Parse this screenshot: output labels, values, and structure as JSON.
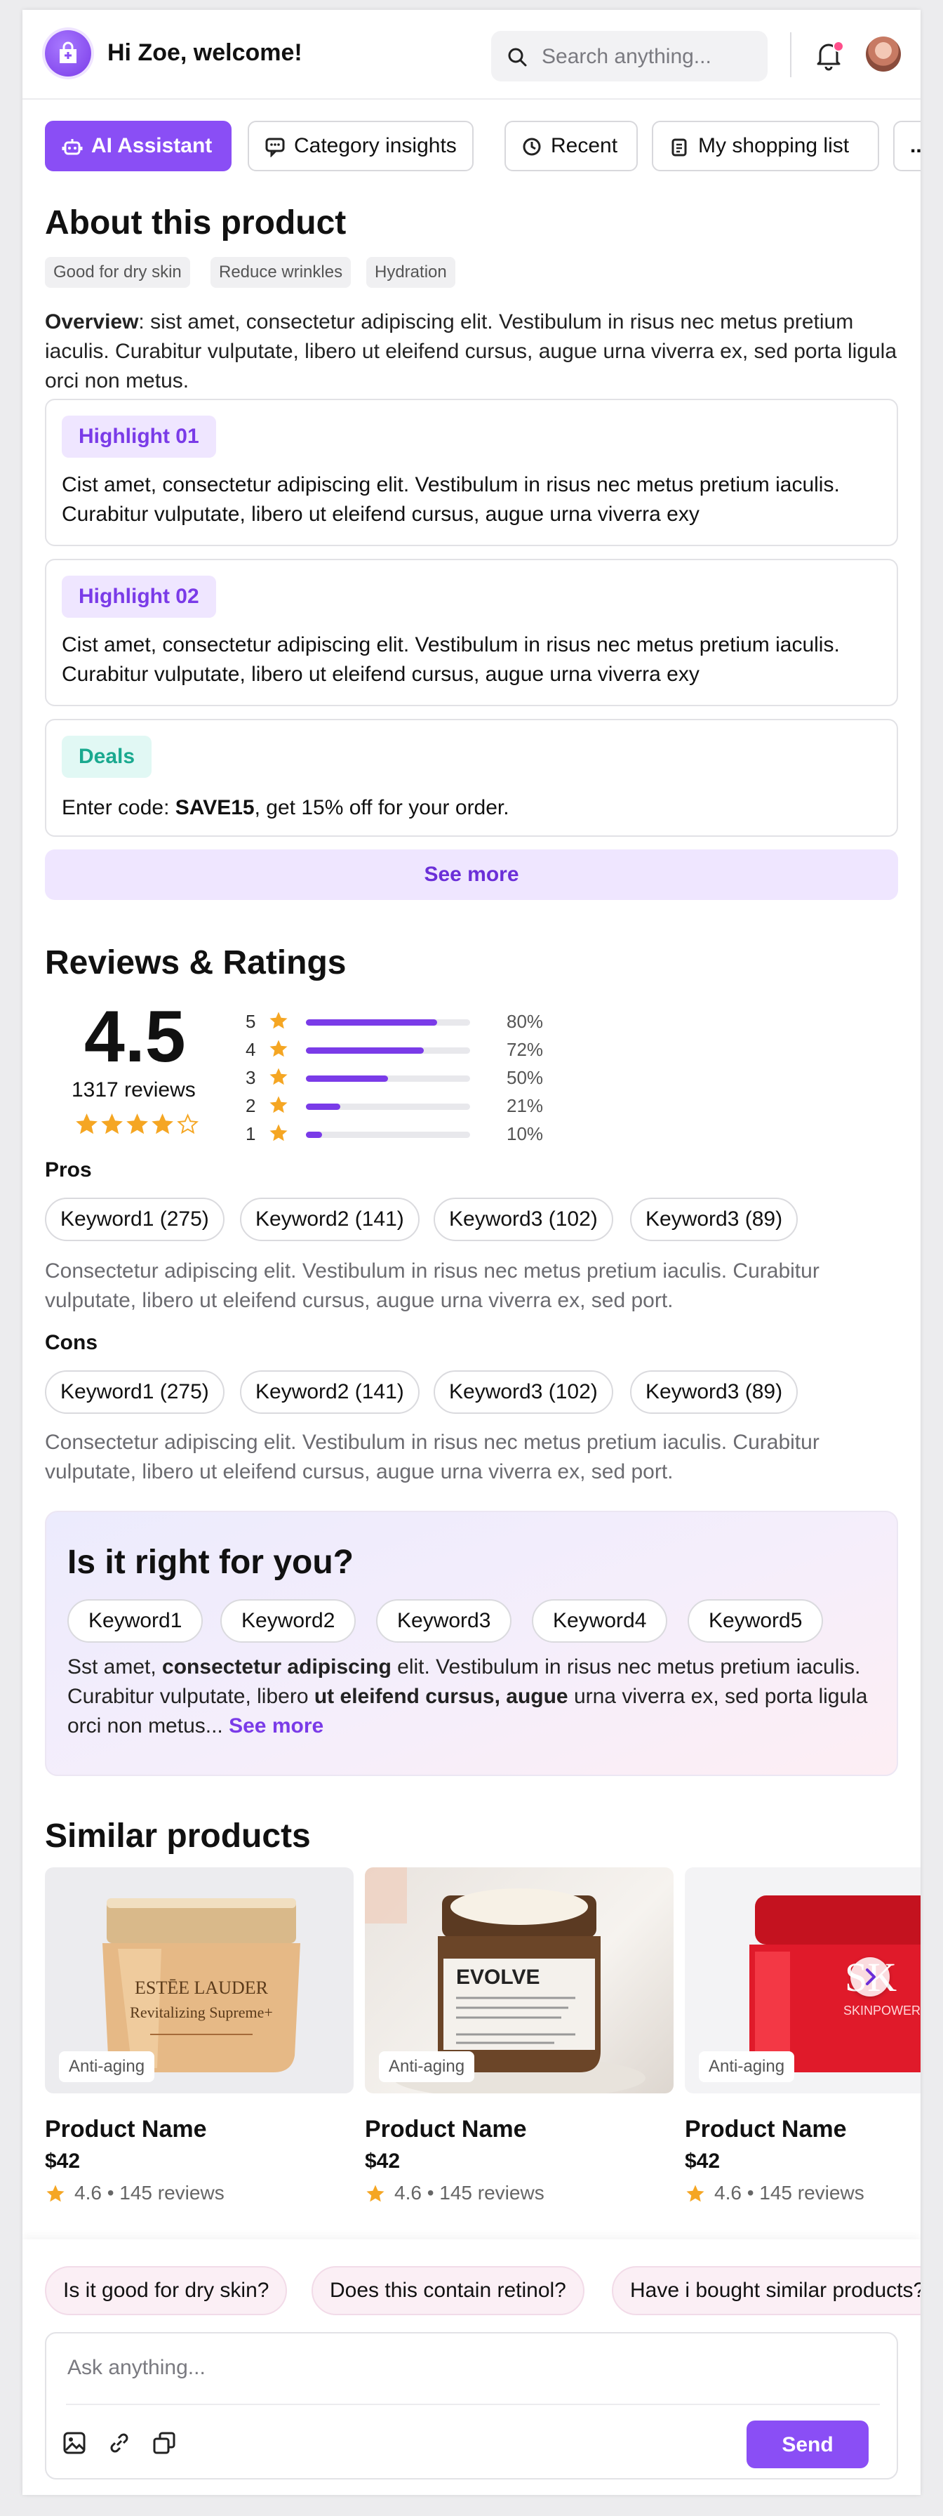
{
  "header": {
    "greeting": "Hi Zoe, welcome!",
    "search_placeholder": "Search anything..."
  },
  "tabs": [
    {
      "label": "AI Assistant",
      "icon": "robot-icon",
      "active": true
    },
    {
      "label": "Category insights",
      "icon": "chat-icon",
      "active": false
    },
    {
      "label": "Recent",
      "icon": "clock-icon",
      "active": false
    },
    {
      "label": "My shopping list",
      "icon": "clipboard-icon",
      "active": false
    },
    {
      "label": "...",
      "icon": "more-icon",
      "active": false
    }
  ],
  "about": {
    "title": "About this product",
    "tags": [
      "Good for dry skin",
      "Reduce wrinkles",
      "Hydration"
    ],
    "overview_label": "Overview",
    "overview_text": ": sist amet, consectetur adipiscing elit. Vestibulum in risus nec metus pretium iaculis. Curabitur vulputate, libero ut eleifend cursus, augue urna viverra ex, sed porta ligula orci non metus.",
    "highlights": [
      {
        "label": "Highlight 01",
        "text": "Cist amet, consectetur adipiscing elit. Vestibulum in risus nec metus pretium iaculis. Curabitur vulputate, libero ut eleifend cursus, augue urna viverra exy"
      },
      {
        "label": "Highlight 02",
        "text": "Cist amet, consectetur adipiscing elit. Vestibulum in risus nec metus pretium iaculis. Curabitur vulputate, libero ut eleifend cursus, augue urna viverra exy"
      }
    ],
    "deals": {
      "label": "Deals",
      "text_before": "Enter code: ",
      "code": "SAVE15",
      "text_after": ", get 15% off for your order."
    },
    "see_more": "See more"
  },
  "reviews": {
    "title": "Reviews & Ratings",
    "score": "4.5",
    "count": "1317 reviews",
    "stars_filled": 4,
    "stars_total": 5,
    "distribution": [
      {
        "stars": "5",
        "pct": "80%",
        "value": 0.8
      },
      {
        "stars": "4",
        "pct": "72%",
        "value": 0.72
      },
      {
        "stars": "3",
        "pct": "50%",
        "value": 0.5
      },
      {
        "stars": "2",
        "pct": "21%",
        "value": 0.21
      },
      {
        "stars": "1",
        "pct": "10%",
        "value": 0.1
      }
    ],
    "pros_label": "Pros",
    "pros_keywords": [
      "Keyword1 (275)",
      "Keyword2 (141)",
      "Keyword3 (102)",
      "Keyword3 (89)"
    ],
    "pros_text": "Consectetur adipiscing elit. Vestibulum in risus nec metus pretium iaculis. Curabitur vulputate, libero ut eleifend cursus, augue urna viverra ex, sed port.",
    "cons_label": "Cons",
    "cons_keywords": [
      "Keyword1 (275)",
      "Keyword2 (141)",
      "Keyword3 (102)",
      "Keyword3 (89)"
    ],
    "cons_text": "Consectetur adipiscing elit. Vestibulum in risus nec metus pretium iaculis. Curabitur vulputate, libero ut eleifend cursus, augue urna viverra ex, sed port."
  },
  "fit": {
    "title": "Is it right for you?",
    "keywords": [
      "Keyword1",
      "Keyword2",
      "Keyword3",
      "Keyword4",
      "Keyword5"
    ],
    "t1": "Sst amet, ",
    "b1": "consectetur adipiscing",
    "t2": " elit. Vestibulum in risus nec metus pretium iaculis. Curabitur vulputate, libero ",
    "b2": "ut eleifend cursus, augue",
    "t3": " urna viverra ex, sed porta ligula orci non metus... ",
    "see_more": "See more"
  },
  "similar": {
    "title": "Similar products",
    "products": [
      {
        "tag": "Anti-aging",
        "name": "Product Name",
        "price": "$42",
        "rating": "4.6 • 145 reviews",
        "brand": "ESTĒE LAUDER",
        "product_line": "Revitalizing Supreme+"
      },
      {
        "tag": "Anti-aging",
        "name": "Product Name",
        "price": "$42",
        "rating": "4.6 • 145 reviews",
        "brand": "EVOLVE"
      },
      {
        "tag": "Anti-aging",
        "name": "Product Name",
        "price": "$42",
        "rating": "4.6 • 145 reviews",
        "brand": "SK",
        "product_line": "SKINPOWER"
      }
    ]
  },
  "suggestions": [
    "Is it good for dry skin?",
    "Does this contain retinol?",
    "Have i bought similar products?"
  ],
  "composer": {
    "placeholder": "Ask anything...",
    "send_label": "Send"
  },
  "colors": {
    "accent": "#8a4ef5",
    "accent_light": "#efe6ff",
    "star": "#f5a623",
    "deals": "#1aa98f"
  }
}
